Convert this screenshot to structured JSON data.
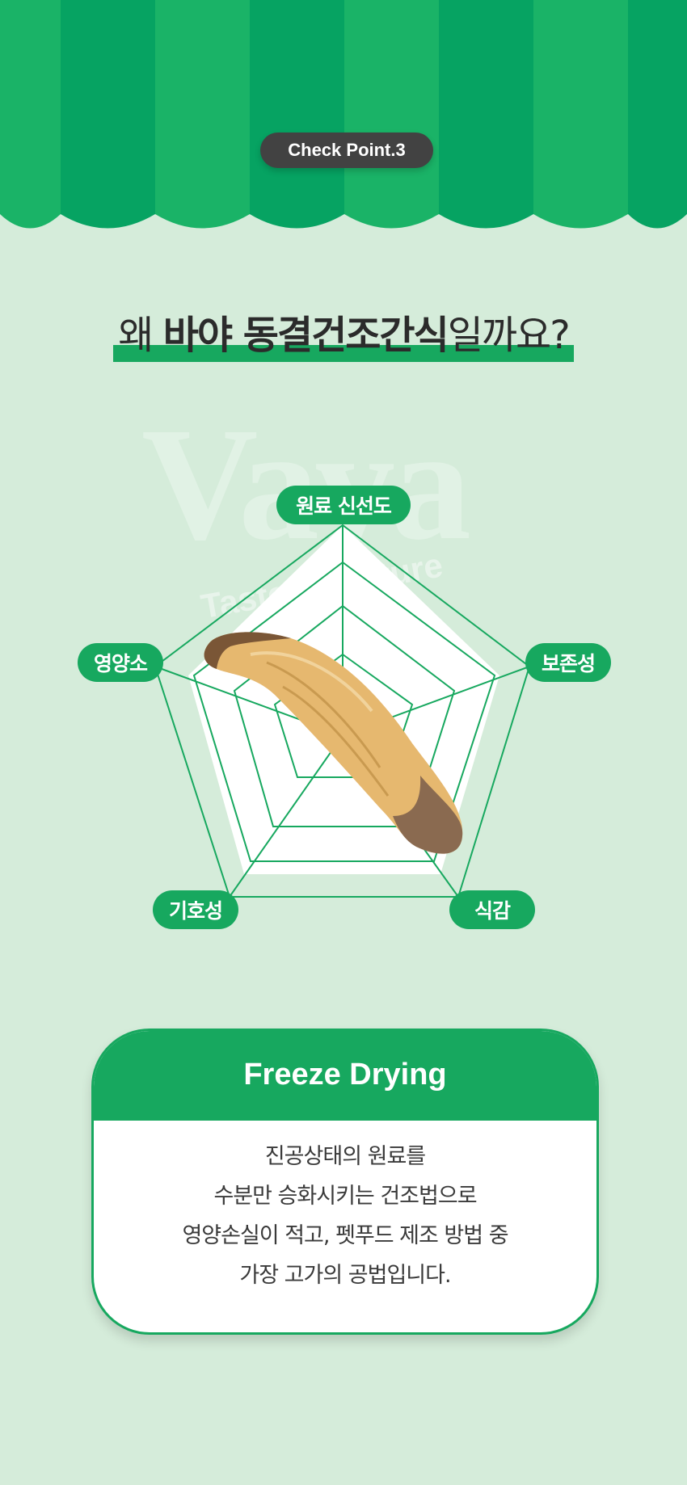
{
  "badge": {
    "label": "Check Point.3"
  },
  "headline": {
    "prefix": "왜 ",
    "bold": "바야 동결건조간식",
    "suffix": "일까요?"
  },
  "watermark": {
    "brand": "Vaya",
    "tagline": "Taste of Nature"
  },
  "radar": {
    "axes": [
      "원료 신선도",
      "보존성",
      "식감",
      "기호성",
      "영양소"
    ],
    "levels": 4,
    "colors": {
      "line": "#17a85f",
      "pill": "#17a85f"
    }
  },
  "card": {
    "title": "Freeze Drying",
    "lines": [
      "진공상태의 원료를",
      "수분만 승화시키는 건조법으로",
      "영양손실이 적고, 펫푸드 제조 방법 중",
      "가장 고가의 공법입니다."
    ]
  },
  "colors": {
    "background": "#d5ecda",
    "green_dark": "#06a362",
    "green_light": "#1ab367",
    "badge": "#424242"
  },
  "image": {
    "subject": "freeze-dried shiitake mushroom slice"
  }
}
